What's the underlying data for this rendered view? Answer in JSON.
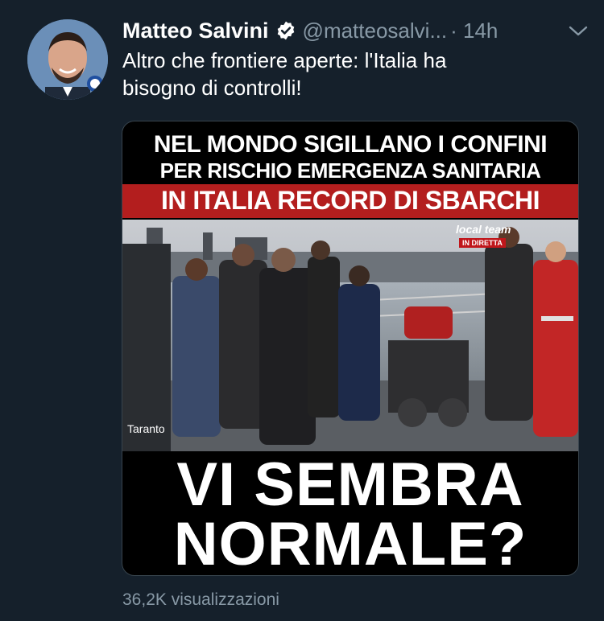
{
  "tweet": {
    "author_name": "Matteo Salvini",
    "handle": "@matteosalvi...",
    "time": "· 14h",
    "text_line1": "Altro che frontiere aperte: l'Italia ha",
    "text_line2": "bisogno di controlli!",
    "views": "36,2K visualizzazioni"
  },
  "media": {
    "headline_line1": "NEL MONDO SIGILLANO I CONFINI",
    "headline_line2": "PER RISCHIO EMERGENZA SANITARIA",
    "headline_line3": "IN ITALIA RECORD DI SBARCHI",
    "location_label": "Taranto",
    "broadcaster": "local team",
    "live_badge": "IN DIRETTA",
    "caption_line1": "VI SEMBRA",
    "caption_line2": "NORMALE?"
  },
  "colors": {
    "background": "#15202b",
    "secondary_text": "#8899a6",
    "verified_badge": "#ffffff",
    "headline_band": "#b31e1e"
  },
  "icons": [
    "verified-badge-icon",
    "chevron-down-icon"
  ]
}
